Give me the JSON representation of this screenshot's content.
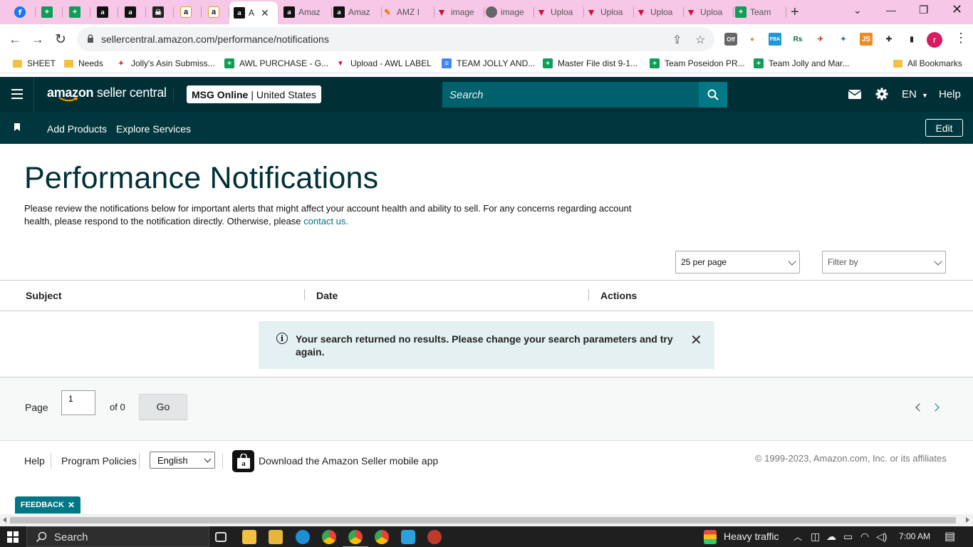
{
  "browser": {
    "tabs": [
      {
        "icon": "facebook-icon",
        "glyph": "f",
        "label": "",
        "kind": "fb"
      },
      {
        "icon": "sheets-icon",
        "glyph": "+",
        "label": "",
        "kind": "sheet"
      },
      {
        "icon": "sheets-icon",
        "glyph": "+",
        "label": "",
        "kind": "sheet"
      },
      {
        "icon": "amazon-icon",
        "glyph": "a",
        "label": "",
        "kind": "amz"
      },
      {
        "icon": "amazon-icon",
        "glyph": "a",
        "label": "",
        "kind": "amz"
      },
      {
        "icon": "pirate-icon",
        "glyph": "☠",
        "label": "",
        "kind": "pirate"
      },
      {
        "icon": "amazon-smile-icon",
        "glyph": "a",
        "label": "",
        "kind": "amz2"
      },
      {
        "icon": "amazon-smile-icon",
        "glyph": "a",
        "label": "",
        "kind": "amz2"
      },
      {
        "icon": "amazon-icon",
        "glyph": "a",
        "label": "A",
        "kind": "amz",
        "active": true
      },
      {
        "icon": "amazon-icon",
        "glyph": "a",
        "label": "Amaz",
        "kind": "amz"
      },
      {
        "icon": "amazon-icon",
        "glyph": "a",
        "label": "Amaz",
        "kind": "amz"
      },
      {
        "icon": "amz-tool-icon",
        "glyph": "✎",
        "label": "AMZ I",
        "kind": "amzpen"
      },
      {
        "icon": "upload-icon",
        "glyph": "▼",
        "label": "image",
        "kind": "upl"
      },
      {
        "icon": "globe-icon",
        "glyph": "",
        "label": "image",
        "kind": "globe"
      },
      {
        "icon": "upload-icon",
        "glyph": "▼",
        "label": "Uploa",
        "kind": "upl"
      },
      {
        "icon": "upload-icon",
        "glyph": "▼",
        "label": "Uploa",
        "kind": "upl"
      },
      {
        "icon": "upload-icon",
        "glyph": "▼",
        "label": "Uploa",
        "kind": "upl"
      },
      {
        "icon": "upload-icon",
        "glyph": "▼",
        "label": "Uploa",
        "kind": "upl"
      },
      {
        "icon": "sheets-icon",
        "glyph": "+",
        "label": "Team",
        "kind": "sheet"
      }
    ],
    "url": "sellercentral.amazon.com/performance/notifications",
    "bookmarks": [
      {
        "icon": "folder-icon",
        "label": "SHEET",
        "kind": "folder"
      },
      {
        "icon": "folder-icon",
        "label": "Needs",
        "kind": "folder"
      },
      {
        "icon": "jolly-icon",
        "label": "Jolly's Asin Submiss...",
        "kind": "jolly"
      },
      {
        "icon": "sheets-icon",
        "label": "AWL PURCHASE - G...",
        "kind": "sheet"
      },
      {
        "icon": "upload-icon",
        "label": "Upload - AWL LABEL",
        "kind": "upl"
      },
      {
        "icon": "docs-icon",
        "label": "TEAM JOLLY AND...",
        "kind": "docs"
      },
      {
        "icon": "sheets-icon",
        "label": "Master File dist 9-1...",
        "kind": "sheet"
      },
      {
        "icon": "sheets-icon",
        "label": "Team Poseidon PR...",
        "kind": "sheet"
      },
      {
        "icon": "sheets-icon",
        "label": "Team Jolly and Mar...",
        "kind": "sheet"
      }
    ],
    "all_bookmarks": "All Bookmarks",
    "extensions": [
      {
        "icon": "off-extension-icon",
        "glyph": "Off",
        "color": "#555"
      },
      {
        "icon": "orange-extension-icon",
        "glyph": "●",
        "color": "#ef8a2b"
      },
      {
        "icon": "fba-extension-icon",
        "glyph": "FBA",
        "color": "#1c9ad6"
      },
      {
        "icon": "rs-extension-icon",
        "glyph": "Rs",
        "color": "#0a6b38"
      },
      {
        "icon": "dhl-extension-icon",
        "glyph": "✈",
        "color": "#c0392b"
      },
      {
        "icon": "helium-extension-icon",
        "glyph": "✦",
        "color": "#2a6ebb"
      },
      {
        "icon": "js-extension-icon",
        "glyph": "JS",
        "color": "#f08a24"
      },
      {
        "icon": "puzzle-icon",
        "glyph": "✚",
        "color": "#333"
      },
      {
        "icon": "sidepanel-icon",
        "glyph": "▮",
        "color": "#222"
      }
    ],
    "profile_initial": "r"
  },
  "header": {
    "logo_bold": "amazon",
    "logo_light": " seller central",
    "store_name": "MSG Online",
    "store_region": "| United States",
    "search_placeholder": "Search",
    "language": "EN",
    "help": "Help"
  },
  "subnav": {
    "links": [
      "Add Products",
      "Explore Services"
    ],
    "edit": "Edit"
  },
  "main": {
    "title": "Performance Notifications",
    "intro": "Please review the notifications below for important alerts that might affect your account health and ability to sell. For any concerns regarding account health, please respond to the notification directly. Otherwise, please ",
    "contact_link": "contact us.",
    "per_page": "25 per page",
    "filter_placeholder": "Filter by",
    "columns": [
      "Subject",
      "Date",
      "Actions"
    ],
    "empty_message": "Your search returned no results. Please change your search parameters and try again.",
    "pager": {
      "label": "Page",
      "current": "1",
      "of": "of 0",
      "go": "Go"
    }
  },
  "footer": {
    "links": [
      "Help",
      "Program Policies"
    ],
    "language": "English",
    "app_text": "Download the Amazon Seller mobile app",
    "copyright": "© 1999-2023, Amazon.com, Inc. or its affiliates",
    "feedback": "FEEDBACK"
  },
  "taskbar": {
    "search": "Search",
    "traffic": "Heavy traffic",
    "time": "7:00 AM"
  },
  "colors": {
    "header_bg": "#002f36",
    "subnav_bg": "#00373f",
    "link": "#007185",
    "alert_bg": "#e4f0f1",
    "tab_strip": "#f6c7e6"
  }
}
